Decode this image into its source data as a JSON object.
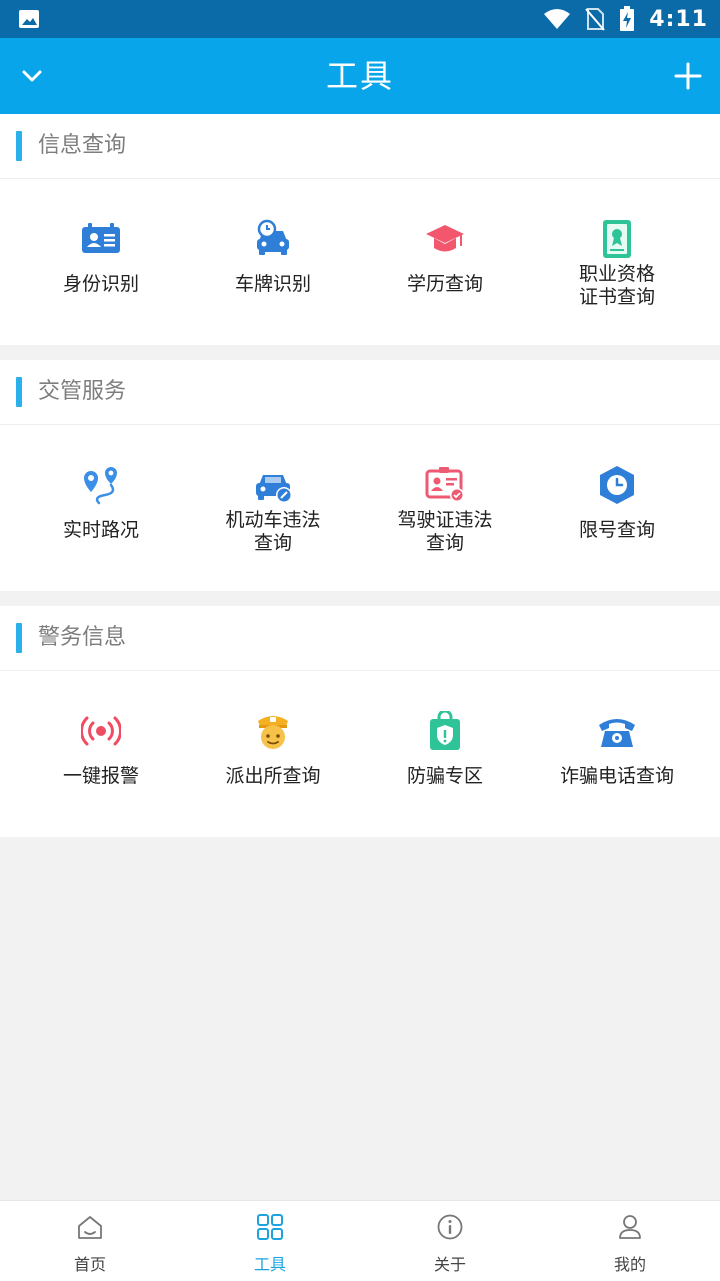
{
  "status_bar": {
    "time": "4:11"
  },
  "header": {
    "title": "工具"
  },
  "sections": [
    {
      "title": "信息查询",
      "items": [
        {
          "label": "身份识别",
          "icon": "id-card-icon"
        },
        {
          "label": "车牌识别",
          "icon": "car-clock-icon"
        },
        {
          "label": "学历查询",
          "icon": "graduation-cap-icon"
        },
        {
          "label": "职业资格\n证书查询",
          "icon": "certificate-book-icon"
        }
      ]
    },
    {
      "title": "交管服务",
      "items": [
        {
          "label": "实时路况",
          "icon": "route-pin-icon"
        },
        {
          "label": "机动车违法\n查询",
          "icon": "car-violation-icon"
        },
        {
          "label": "驾驶证违法\n查询",
          "icon": "license-violation-icon"
        },
        {
          "label": "限号查询",
          "icon": "clock-hexagon-icon"
        }
      ]
    },
    {
      "title": "警务信息",
      "items": [
        {
          "label": "一键报警",
          "icon": "alarm-broadcast-icon"
        },
        {
          "label": "派出所查询",
          "icon": "police-officer-icon"
        },
        {
          "label": "防骗专区",
          "icon": "shield-lock-icon"
        },
        {
          "label": "诈骗电话查询",
          "icon": "telephone-icon"
        }
      ]
    }
  ],
  "tabbar": {
    "items": [
      {
        "label": "首页",
        "icon": "home-icon"
      },
      {
        "label": "工具",
        "icon": "grid-icon",
        "active": true
      },
      {
        "label": "关于",
        "icon": "info-icon"
      },
      {
        "label": "我的",
        "icon": "user-icon"
      }
    ]
  },
  "colors": {
    "status_bar": "#0b6aa8",
    "app_bar": "#08a5ea",
    "accent": "#1da4e0",
    "section_marker": "#2ab0ea"
  }
}
